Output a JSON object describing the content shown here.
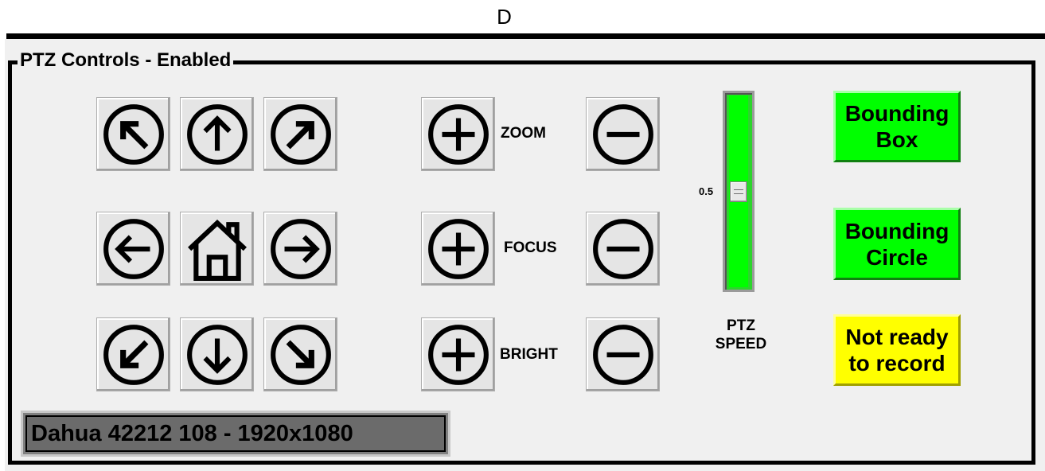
{
  "top_letter": "D",
  "panel": {
    "title": "PTZ Controls - Enabled"
  },
  "direction_pad": {
    "up_left": "arrow-up-left-icon",
    "up": "arrow-up-icon",
    "up_right": "arrow-up-right-icon",
    "left": "arrow-left-icon",
    "home": "home-icon",
    "right": "arrow-right-icon",
    "down_left": "arrow-down-left-icon",
    "down": "arrow-down-icon",
    "down_right": "arrow-down-right-icon"
  },
  "adjustments": [
    {
      "label": "ZOOM",
      "increase_icon": "plus-circle-icon",
      "decrease_icon": "minus-circle-icon"
    },
    {
      "label": "FOCUS",
      "increase_icon": "plus-circle-icon",
      "decrease_icon": "minus-circle-icon"
    },
    {
      "label": "BRIGHT",
      "increase_icon": "plus-circle-icon",
      "decrease_icon": "minus-circle-icon"
    }
  ],
  "ptz_speed": {
    "value": "0.5",
    "label_line1": "PTZ",
    "label_line2": "SPEED"
  },
  "buttons": {
    "bounding_box_line1": "Bounding",
    "bounding_box_line2": "Box",
    "bounding_circle_line1": "Bounding",
    "bounding_circle_line2": "Circle",
    "record_line1": "Not ready",
    "record_line2": "to record"
  },
  "camera": {
    "info": "Dahua 42212 108 - 1920x1080"
  },
  "colors": {
    "panel_background": "#f0f0f0",
    "slider_green": "#00ff00",
    "bounding_green": "#00ff00",
    "record_yellow": "#ffff00",
    "camera_info_background": "#808080"
  }
}
